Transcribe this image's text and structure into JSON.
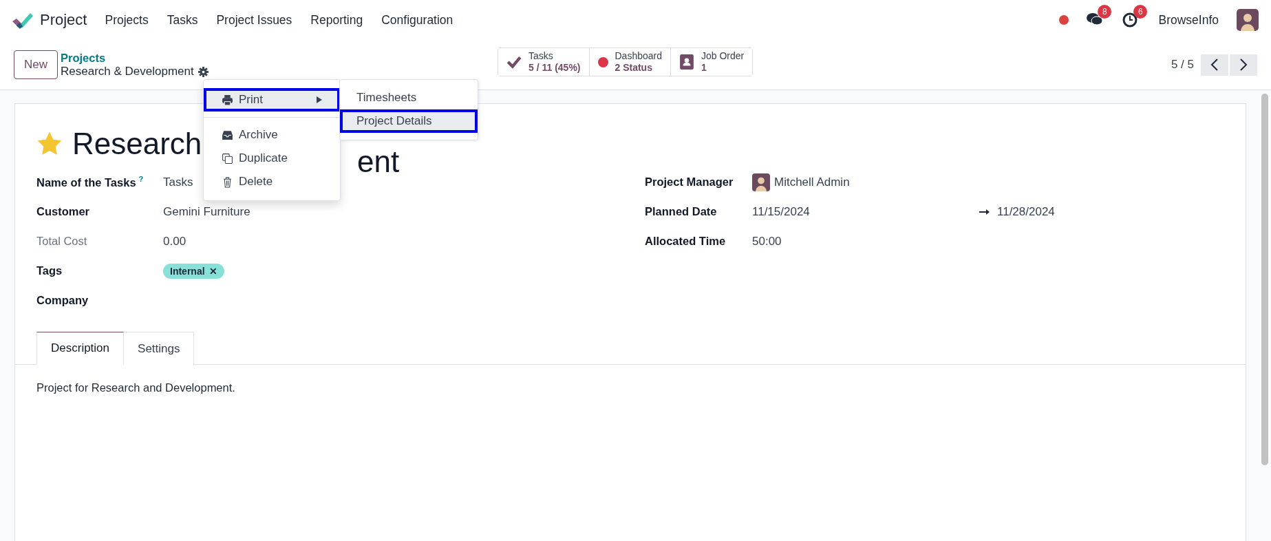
{
  "navbar": {
    "app_name": "Project",
    "menu": [
      "Projects",
      "Tasks",
      "Project Issues",
      "Reporting",
      "Configuration"
    ],
    "messages_count": "8",
    "activities_count": "6",
    "user": "BrowseInfo"
  },
  "control_panel": {
    "new_button": "New",
    "breadcrumb": "Projects",
    "current": "Research & Development",
    "smart_buttons": [
      {
        "kind": "check",
        "label": "Tasks",
        "value": "5 / 11 (45%)"
      },
      {
        "kind": "dot",
        "label": "Dashboard",
        "value": "2 Status",
        "color": "#dc3545"
      },
      {
        "kind": "contact",
        "label": "Job Order",
        "value": "1"
      }
    ],
    "pager": "5 / 5"
  },
  "form": {
    "title_visible_parts": [
      "Research",
      "ent"
    ],
    "favorite": true,
    "left_fields": [
      {
        "label": "Name of the Tasks",
        "help": "?",
        "value": "Tasks",
        "muted": false
      },
      {
        "label": "Customer",
        "value": "Gemini Furniture",
        "muted": false
      },
      {
        "label": "Total Cost",
        "value": "0.00",
        "muted": true
      },
      {
        "label": "Tags",
        "tags": [
          {
            "label": "Internal",
            "color": "#87e1d9",
            "remove": "✕"
          }
        ],
        "muted": false
      },
      {
        "label": "Company",
        "muted": false
      }
    ],
    "right_fields": [
      {
        "kind": "user",
        "label": "Project Manager",
        "value": "Mitchell Admin"
      },
      {
        "kind": "daterange",
        "label": "Planned Date",
        "start": "11/15/2024",
        "end": "11/28/2024"
      },
      {
        "kind": "text",
        "label": "Allocated Time",
        "value": "50:00"
      }
    ],
    "tabs": [
      {
        "label": "Description",
        "selected": true
      },
      {
        "label": "Settings",
        "selected": false
      }
    ],
    "description": "Project for Research and Development."
  },
  "action_menu": {
    "items": [
      {
        "kind": "print",
        "label": "Print",
        "selected": true,
        "submenu": true
      },
      {
        "kind": "archive",
        "label": "Archive",
        "selected": false,
        "submenu": false
      },
      {
        "kind": "duplicate",
        "label": "Duplicate",
        "selected": false,
        "submenu": false
      },
      {
        "kind": "delete",
        "label": "Delete",
        "selected": false,
        "submenu": false
      }
    ],
    "submenu": [
      {
        "label": "Timesheets",
        "selected": false
      },
      {
        "label": "Project Details",
        "selected": true
      }
    ]
  }
}
